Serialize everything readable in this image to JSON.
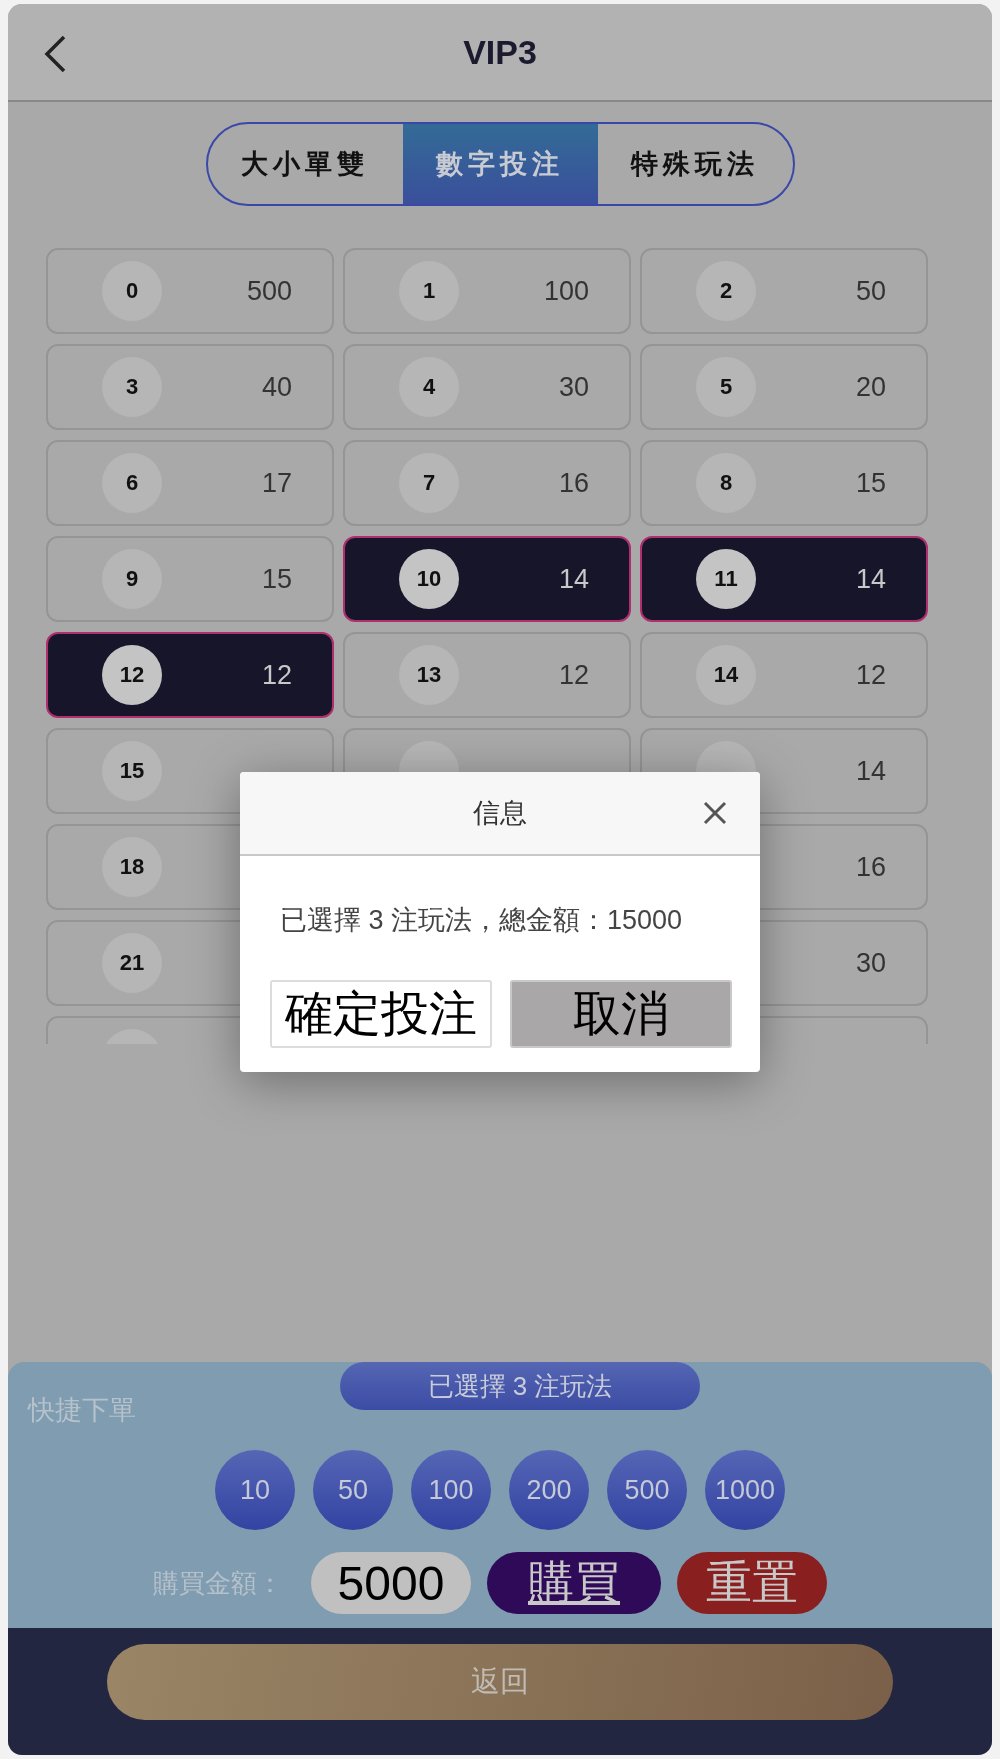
{
  "header": {
    "title": "VIP3"
  },
  "tabs": [
    {
      "label": "大小單雙",
      "selected": false
    },
    {
      "label": "數字投注",
      "selected": true
    },
    {
      "label": "特殊玩法",
      "selected": false
    }
  ],
  "bet_rows": [
    {
      "column_1": {
        "kind": "ball",
        "number": "0",
        "odds": "500",
        "selected": false
      },
      "column_2": {
        "kind": "ball",
        "number": "1",
        "odds": "100",
        "selected": false
      },
      "column_3": {
        "kind": "ball",
        "number": "2",
        "odds": "50",
        "selected": false
      }
    },
    {
      "column_1": {
        "kind": "ball",
        "number": "3",
        "odds": "40",
        "selected": false
      },
      "column_2": {
        "kind": "ball",
        "number": "4",
        "odds": "30",
        "selected": false
      },
      "column_3": {
        "kind": "ball",
        "number": "5",
        "odds": "20",
        "selected": false
      }
    },
    {
      "column_1": {
        "kind": "ball",
        "number": "6",
        "odds": "17",
        "selected": false
      },
      "column_2": {
        "kind": "ball",
        "number": "7",
        "odds": "16",
        "selected": false
      },
      "column_3": {
        "kind": "ball",
        "number": "8",
        "odds": "15",
        "selected": false
      }
    },
    {
      "column_1": {
        "kind": "ball",
        "number": "9",
        "odds": "15",
        "selected": false
      },
      "column_2": {
        "kind": "ball",
        "number": "10",
        "odds": "14",
        "selected": true
      },
      "column_3": {
        "kind": "ball",
        "number": "11",
        "odds": "14",
        "selected": true
      }
    },
    {
      "column_1": {
        "kind": "ball",
        "number": "12",
        "odds": "12",
        "selected": true
      },
      "column_2": {
        "kind": "ball",
        "number": "13",
        "odds": "12",
        "selected": false
      },
      "column_3": {
        "kind": "ball",
        "number": "14",
        "odds": "12",
        "selected": false
      }
    },
    {
      "column_1": {
        "kind": "ball",
        "number": "15",
        "selected": false
      },
      "column_2": {
        "kind": "ball",
        "selected": false
      },
      "column_3": {
        "kind": "ball",
        "odds": "14",
        "selected": false
      }
    },
    {
      "column_1": {
        "kind": "ball",
        "number": "18",
        "selected": false
      },
      "column_3": {
        "kind": "plain",
        "odds": "16",
        "selected": false
      }
    },
    {
      "column_1": {
        "kind": "ball",
        "number": "21",
        "selected": false
      },
      "column_3": {
        "kind": "plain",
        "odds": "30",
        "selected": false
      }
    },
    {
      "column_1": {
        "kind": "ball",
        "selected": false
      },
      "column_3": {
        "kind": "plain",
        "selected": false
      }
    }
  ],
  "dialog": {
    "title": "信息",
    "message": "已選擇 3 注玩法，總金額：15000",
    "buttons": [
      {
        "label": "確定投注",
        "kind": "confirm"
      },
      {
        "label": "取消",
        "kind": "cancel"
      }
    ]
  },
  "quick_order": {
    "selection_summary": "已選擇 3 注玩法",
    "label": "快捷下單",
    "chips": [
      "10",
      "50",
      "100",
      "200",
      "500",
      "1000"
    ],
    "amount_label": "購買金額：",
    "amount_value": "5000",
    "buy_button": "購買",
    "reset_button": "重置"
  },
  "footer": {
    "back_button": "返回"
  }
}
